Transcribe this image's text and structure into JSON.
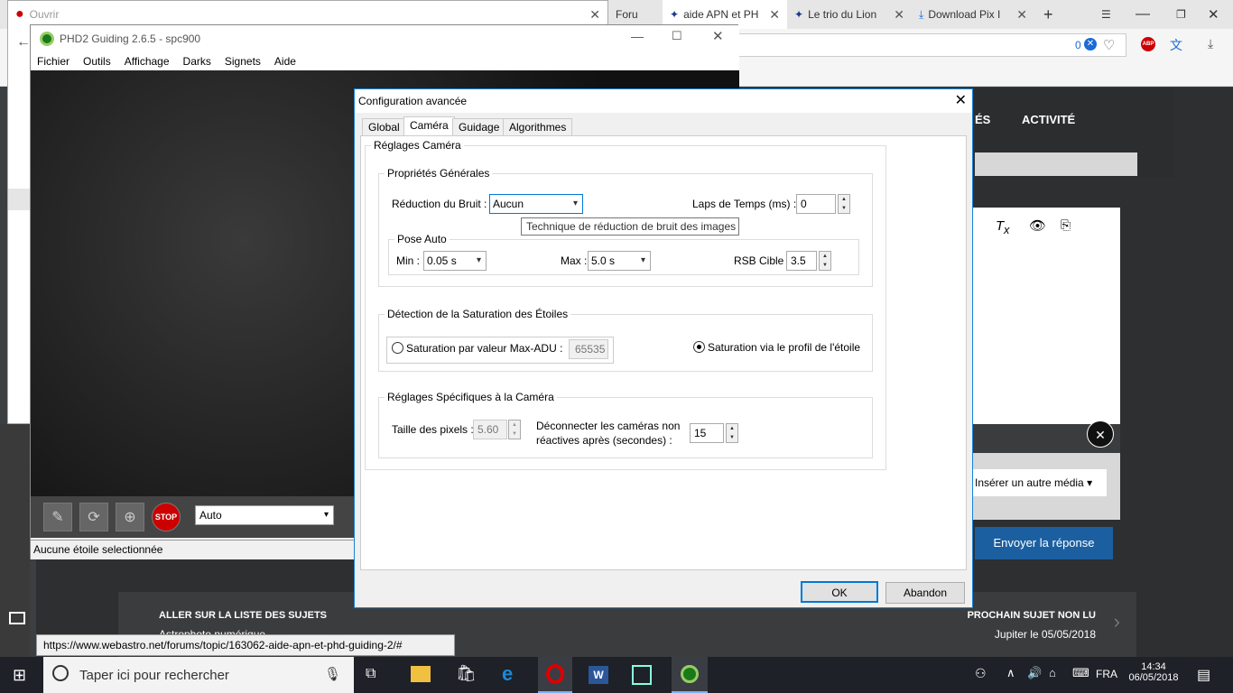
{
  "browser": {
    "tabs": [
      {
        "title": "Ouvrir"
      },
      {
        "title": "Foru"
      },
      {
        "title": "aide APN et PH"
      },
      {
        "title": "Le trio du Lion"
      },
      {
        "title": "Download Pix I"
      }
    ],
    "url_counter": "0",
    "site_nav_1": "ÉS",
    "site_nav_2": "ACTIVITÉ",
    "insert_media": "Insérer un autre média",
    "send_reply": "Envoyer la réponse",
    "prev_label": "ALLER SUR LA LISTE DES SUJETS",
    "prev_sub": "Astrophoto numérique",
    "next_label": "PROCHAIN SUJET NON LU",
    "next_sub": "Jupiter le 05/05/2018",
    "status_url": "https://www.webastro.net/forums/topic/163062-aide-apn-et-phd-guiding-2/#"
  },
  "phd2": {
    "title": "PHD2 Guiding 2.6.5 - spc900",
    "menu": [
      "Fichier",
      "Outils",
      "Affichage",
      "Darks",
      "Signets",
      "Aide"
    ],
    "exposure": "Auto",
    "status": "Aucune étoile selectionnée",
    "stop_label": "STOP"
  },
  "dialog": {
    "title": "Configuration avancée",
    "tabs": [
      "Global",
      "Caméra",
      "Guidage",
      "Algorithmes"
    ],
    "section_camera": "Réglages Caméra",
    "general_props": "Propriétés Générales",
    "noise_label": "Réduction du Bruit :",
    "noise_value": "Aucun",
    "tooltip": "Technique de réduction de bruit des images",
    "timelapse_label": "Laps de Temps (ms) :",
    "timelapse_value": "0",
    "autoexp": "Pose Auto",
    "min_label": "Min :",
    "min_value": "0.05 s",
    "max_label": "Max :",
    "max_value": "5.0 s",
    "snr_label": "RSB Cible :",
    "snr_value": "3.5",
    "saturation_group": "Détection de la Saturation des Étoiles",
    "sat_maxadu": "Saturation par valeur Max-ADU :",
    "sat_maxadu_value": "65535",
    "sat_profile": "Saturation via le profil de l'étoile",
    "specific_group": "Réglages Spécifiques à la Caméra",
    "pixel_size_label": "Taille des pixels :",
    "pixel_size_value": "5.60",
    "disconnect_label_1": "Déconnecter les caméras non",
    "disconnect_label_2": "réactives après (secondes) :",
    "disconnect_value": "15",
    "ok": "OK",
    "cancel": "Abandon"
  },
  "taskbar": {
    "search": "Taper ici pour rechercher",
    "lang": "FRA",
    "time": "14:34",
    "date": "06/05/2018"
  }
}
